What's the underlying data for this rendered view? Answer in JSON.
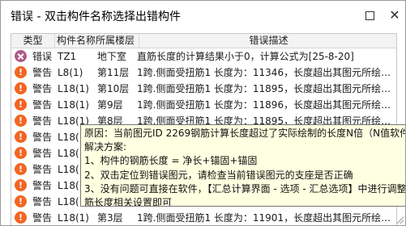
{
  "window": {
    "title": "错误 - 双击构件名称选择出错构件"
  },
  "grid": {
    "columns": {
      "type": "类型",
      "component": "构件名称",
      "floor": "所属楼层",
      "description": "错误描述"
    },
    "rows": [
      {
        "kind": "error",
        "type": "错误",
        "component": "TZ1",
        "floor": "地下室",
        "description": "直筋长度的计算结果小于0，计算公式为[25-8-20]"
      },
      {
        "kind": "warning",
        "type": "警告",
        "component": "L8(1)",
        "floor": "第11层",
        "description": "1跨.侧面受扭筋1 长度为：11346，长度超出其图元所绘…"
      },
      {
        "kind": "warning",
        "type": "警告",
        "component": "L18(1)",
        "floor": "第10层",
        "description": "1跨.侧面受扭筋1 长度为：11895，长度超出其图元所绘…"
      },
      {
        "kind": "warning",
        "type": "警告",
        "component": "L18(1)",
        "floor": "第9层",
        "description": "1跨.侧面受扭筋1 长度为：11896，长度超出其图元所绘…"
      },
      {
        "kind": "warning",
        "type": "警告",
        "component": "L18(1)",
        "floor": "第8层",
        "description": "1跨.侧面受扭筋1 长度为：11895，长度超出其图元所绘…"
      },
      {
        "kind": "warning",
        "type": "警告",
        "component": "L18(",
        "floor": "",
        "description": ""
      },
      {
        "kind": "warning",
        "type": "警告",
        "component": "L18(",
        "floor": "",
        "description": ""
      },
      {
        "kind": "warning",
        "type": "警告",
        "component": "L18(",
        "floor": "",
        "description": ""
      },
      {
        "kind": "warning",
        "type": "警告",
        "component": "L18(",
        "floor": "",
        "description": ""
      },
      {
        "kind": "warning",
        "type": "警告",
        "component": "L18(",
        "floor": "",
        "description": ""
      },
      {
        "kind": "warning",
        "type": "警告",
        "component": "L18(1)",
        "floor": "第3层",
        "description": "1跨.侧面受扭筋1 长度为：11901，长度超出其图元所绘…"
      }
    ]
  },
  "tooltip": {
    "lines": [
      "原因：当前图元ID 2269钢筋计算长度超过了实际绘制的长度N倍（N值软件",
      "解决方案:",
      "1、构件的钢筋长度 = 净长+锚固+锚固",
      "2、双击定位到错误图元，请检查当前错误图元的支座是否正确",
      "3、没有问题可直接在软件，【汇总计算界面 - 选项 - 汇总选项】中进行调整",
      "筋长度相关设置即可"
    ]
  },
  "icons": {
    "error": "error-x-icon",
    "warning": "warning-exclamation-icon",
    "restore": "restore-icon",
    "close": "close-icon"
  },
  "colors": {
    "warning": "#f26522",
    "error": "#b05a8a",
    "tooltip_bg": "#ffffe1"
  }
}
